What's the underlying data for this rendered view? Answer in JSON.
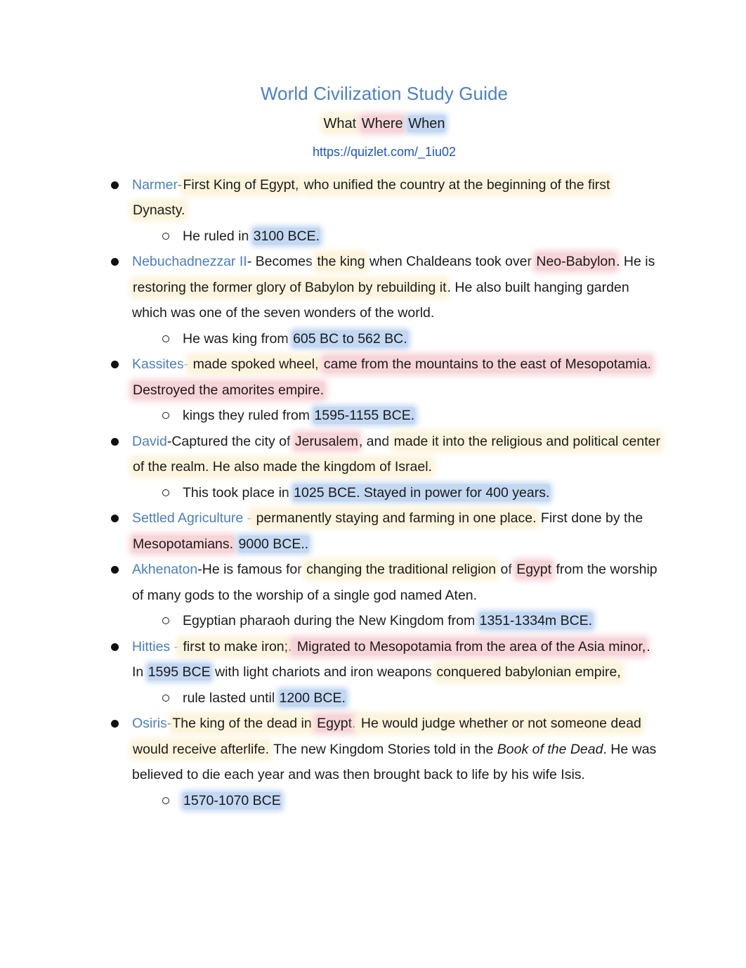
{
  "document": {
    "title": "World Civilization Study Guide",
    "subtitle": {
      "what": "What",
      "where": "Where",
      "when": "When"
    },
    "link": "https://quizlet.com/_1iu02",
    "colors": {
      "title": "#4a7fd0",
      "link": "#1a56d6",
      "term": "#4a7ec4",
      "highlight_what_yellow": "#fdf4dd",
      "highlight_where_pink": "#f7d4d8",
      "highlight_when_blue": "#c3d8f2",
      "text": "#1b1b1b"
    }
  },
  "entries": [
    {
      "term": "Narmer",
      "body_1": "-",
      "what_1": "First King of Egypt,",
      "mid_1": " ",
      "what_2": "who unified the country at the beginning of the first Dynasty.",
      "sub": {
        "lead": "He ruled in ",
        "when": "3100 BCE."
      }
    },
    {
      "term": "Nebuchadnezzar II",
      "lead": "- Becomes ",
      "what_1": "the king",
      "mid_1": " when Chaldeans took over ",
      "where_1": "Neo-Babylon",
      "mid_2": ". He is ",
      "what_2": "restoring the former glory of Babylon by rebuilding it",
      "tail": ". He also built hanging garden which was one of the seven wonders of the world.",
      "sub": {
        "lead": "He was king from ",
        "when": "605 BC to 562 BC."
      }
    },
    {
      "term": "Kassites-",
      "what_1": " made spoked wheel,",
      "mid_1": " ",
      "where_1": "came from the mountains to the east of Mesopotamia. Destroyed the amorites empire.",
      "sub": {
        "lead": "kings they ruled from  ",
        "when": "1595-1155 BCE."
      }
    },
    {
      "term": "David",
      "lead": "-Captured the city of ",
      "where_1": "Jerusalem",
      "mid_1": ", and ",
      "what_1": "made it into the religious and political center of the realm. He also made the kingdom of Israel.",
      "sub": {
        "lead": "This took place in ",
        "when": "1025 BCE. Stayed in power for 400 years."
      }
    },
    {
      "term": "Settled Agriculture -",
      "what_1": " permanently staying and farming in one place.",
      "mid_1": " First done by the ",
      "where_1": "Mesopotamians.",
      "mid_2": " ",
      "when_1": "9000 BCE..",
      "sub": null
    },
    {
      "term": "Akhenaton",
      "lead": "-He is famous for ",
      "what_1": "changing the traditional religion",
      "mid_1": " of ",
      "where_1": "Egypt",
      "tail": " from the worship of many gods to the worship of a single god named Aten.",
      "sub": {
        "lead": "Egyptian pharaoh during the New Kingdom from ",
        "when": "1351-1334m BCE."
      }
    },
    {
      "term": "Hitties -",
      "what_1": " first to make iron;.",
      "where_1": " Migrated to Mesopotamia from the area of the Asia minor,",
      "mid_1": ". In ",
      "when_1": "1595 BCE",
      "mid_2": " with light chariots and iron weapons ",
      "what_2": "conquered babylonian empire,",
      "sub": {
        "lead": "rule lasted until ",
        "when": "1200 BCE."
      }
    },
    {
      "term": "Osiris",
      "lead": "-",
      "what_1": "The king of the dead in ",
      "where_1": "Egypt.",
      "what_2": " He would judge whether or not someone dead would receive afterlife.",
      "mid_1": " The new Kingdom Stories told in the ",
      "italic_1": "Book of the Dead",
      "tail": ". He was believed to die each year and was then brought back to life by his wife Isis.",
      "sub": {
        "lead": "",
        "when": "1570-1070 BCE"
      }
    }
  ]
}
